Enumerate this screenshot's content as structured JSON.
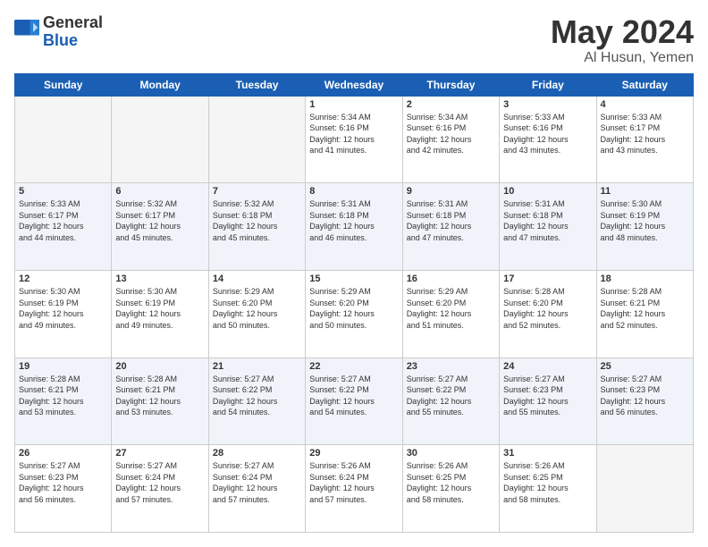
{
  "logo": {
    "general": "General",
    "blue": "Blue"
  },
  "title": {
    "month": "May 2024",
    "location": "Al Husun, Yemen"
  },
  "headers": [
    "Sunday",
    "Monday",
    "Tuesday",
    "Wednesday",
    "Thursday",
    "Friday",
    "Saturday"
  ],
  "weeks": [
    [
      {
        "day": "",
        "info": ""
      },
      {
        "day": "",
        "info": ""
      },
      {
        "day": "",
        "info": ""
      },
      {
        "day": "1",
        "info": "Sunrise: 5:34 AM\nSunset: 6:16 PM\nDaylight: 12 hours\nand 41 minutes."
      },
      {
        "day": "2",
        "info": "Sunrise: 5:34 AM\nSunset: 6:16 PM\nDaylight: 12 hours\nand 42 minutes."
      },
      {
        "day": "3",
        "info": "Sunrise: 5:33 AM\nSunset: 6:16 PM\nDaylight: 12 hours\nand 43 minutes."
      },
      {
        "day": "4",
        "info": "Sunrise: 5:33 AM\nSunset: 6:17 PM\nDaylight: 12 hours\nand 43 minutes."
      }
    ],
    [
      {
        "day": "5",
        "info": "Sunrise: 5:33 AM\nSunset: 6:17 PM\nDaylight: 12 hours\nand 44 minutes."
      },
      {
        "day": "6",
        "info": "Sunrise: 5:32 AM\nSunset: 6:17 PM\nDaylight: 12 hours\nand 45 minutes."
      },
      {
        "day": "7",
        "info": "Sunrise: 5:32 AM\nSunset: 6:18 PM\nDaylight: 12 hours\nand 45 minutes."
      },
      {
        "day": "8",
        "info": "Sunrise: 5:31 AM\nSunset: 6:18 PM\nDaylight: 12 hours\nand 46 minutes."
      },
      {
        "day": "9",
        "info": "Sunrise: 5:31 AM\nSunset: 6:18 PM\nDaylight: 12 hours\nand 47 minutes."
      },
      {
        "day": "10",
        "info": "Sunrise: 5:31 AM\nSunset: 6:18 PM\nDaylight: 12 hours\nand 47 minutes."
      },
      {
        "day": "11",
        "info": "Sunrise: 5:30 AM\nSunset: 6:19 PM\nDaylight: 12 hours\nand 48 minutes."
      }
    ],
    [
      {
        "day": "12",
        "info": "Sunrise: 5:30 AM\nSunset: 6:19 PM\nDaylight: 12 hours\nand 49 minutes."
      },
      {
        "day": "13",
        "info": "Sunrise: 5:30 AM\nSunset: 6:19 PM\nDaylight: 12 hours\nand 49 minutes."
      },
      {
        "day": "14",
        "info": "Sunrise: 5:29 AM\nSunset: 6:20 PM\nDaylight: 12 hours\nand 50 minutes."
      },
      {
        "day": "15",
        "info": "Sunrise: 5:29 AM\nSunset: 6:20 PM\nDaylight: 12 hours\nand 50 minutes."
      },
      {
        "day": "16",
        "info": "Sunrise: 5:29 AM\nSunset: 6:20 PM\nDaylight: 12 hours\nand 51 minutes."
      },
      {
        "day": "17",
        "info": "Sunrise: 5:28 AM\nSunset: 6:20 PM\nDaylight: 12 hours\nand 52 minutes."
      },
      {
        "day": "18",
        "info": "Sunrise: 5:28 AM\nSunset: 6:21 PM\nDaylight: 12 hours\nand 52 minutes."
      }
    ],
    [
      {
        "day": "19",
        "info": "Sunrise: 5:28 AM\nSunset: 6:21 PM\nDaylight: 12 hours\nand 53 minutes."
      },
      {
        "day": "20",
        "info": "Sunrise: 5:28 AM\nSunset: 6:21 PM\nDaylight: 12 hours\nand 53 minutes."
      },
      {
        "day": "21",
        "info": "Sunrise: 5:27 AM\nSunset: 6:22 PM\nDaylight: 12 hours\nand 54 minutes."
      },
      {
        "day": "22",
        "info": "Sunrise: 5:27 AM\nSunset: 6:22 PM\nDaylight: 12 hours\nand 54 minutes."
      },
      {
        "day": "23",
        "info": "Sunrise: 5:27 AM\nSunset: 6:22 PM\nDaylight: 12 hours\nand 55 minutes."
      },
      {
        "day": "24",
        "info": "Sunrise: 5:27 AM\nSunset: 6:23 PM\nDaylight: 12 hours\nand 55 minutes."
      },
      {
        "day": "25",
        "info": "Sunrise: 5:27 AM\nSunset: 6:23 PM\nDaylight: 12 hours\nand 56 minutes."
      }
    ],
    [
      {
        "day": "26",
        "info": "Sunrise: 5:27 AM\nSunset: 6:23 PM\nDaylight: 12 hours\nand 56 minutes."
      },
      {
        "day": "27",
        "info": "Sunrise: 5:27 AM\nSunset: 6:24 PM\nDaylight: 12 hours\nand 57 minutes."
      },
      {
        "day": "28",
        "info": "Sunrise: 5:27 AM\nSunset: 6:24 PM\nDaylight: 12 hours\nand 57 minutes."
      },
      {
        "day": "29",
        "info": "Sunrise: 5:26 AM\nSunset: 6:24 PM\nDaylight: 12 hours\nand 57 minutes."
      },
      {
        "day": "30",
        "info": "Sunrise: 5:26 AM\nSunset: 6:25 PM\nDaylight: 12 hours\nand 58 minutes."
      },
      {
        "day": "31",
        "info": "Sunrise: 5:26 AM\nSunset: 6:25 PM\nDaylight: 12 hours\nand 58 minutes."
      },
      {
        "day": "",
        "info": ""
      }
    ]
  ]
}
